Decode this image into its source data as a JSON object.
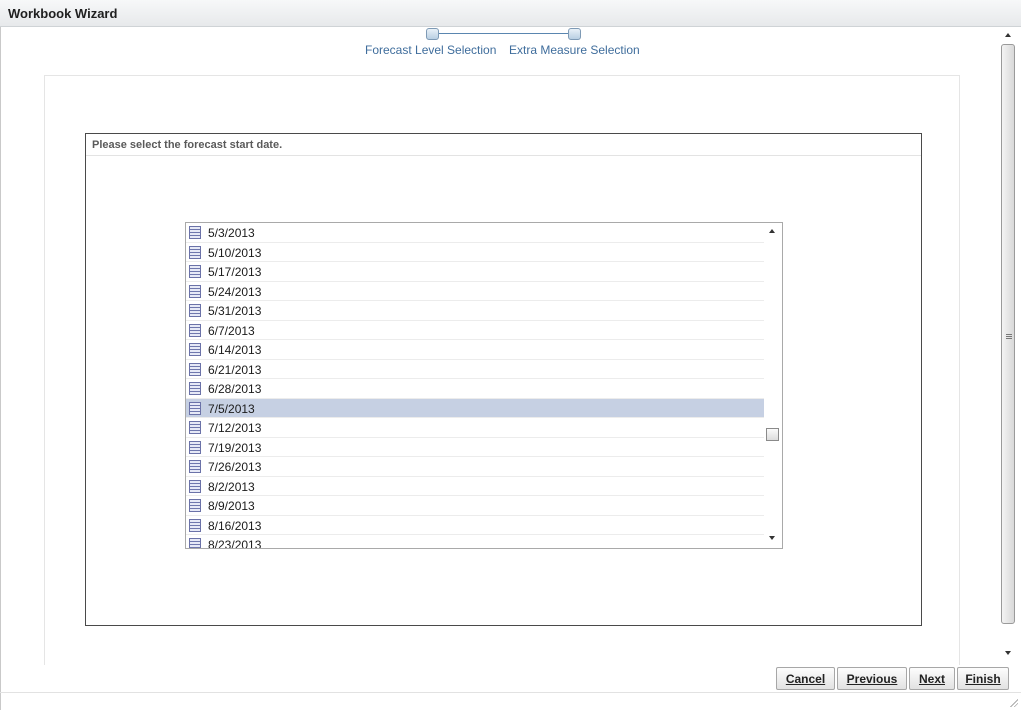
{
  "window": {
    "title": "Workbook Wizard"
  },
  "train": {
    "steps": [
      {
        "label": "Forecast Level Selection"
      },
      {
        "label": "Extra Measure Selection"
      }
    ]
  },
  "panel": {
    "prompt": "Please select the forecast start date."
  },
  "dates": {
    "items": [
      "5/3/2013",
      "5/10/2013",
      "5/17/2013",
      "5/24/2013",
      "5/31/2013",
      "6/7/2013",
      "6/14/2013",
      "6/21/2013",
      "6/28/2013",
      "7/5/2013",
      "7/12/2013",
      "7/19/2013",
      "7/26/2013",
      "8/2/2013",
      "8/9/2013",
      "8/16/2013",
      "8/23/2013"
    ],
    "selected": "7/5/2013",
    "item_icon": "document-icon"
  },
  "buttons": {
    "cancel": "Cancel",
    "previous": "Previous",
    "next": "Next",
    "finish": "Finish"
  },
  "colors": {
    "selection": "#c6d0e3",
    "train_text": "#3f6d9c"
  }
}
